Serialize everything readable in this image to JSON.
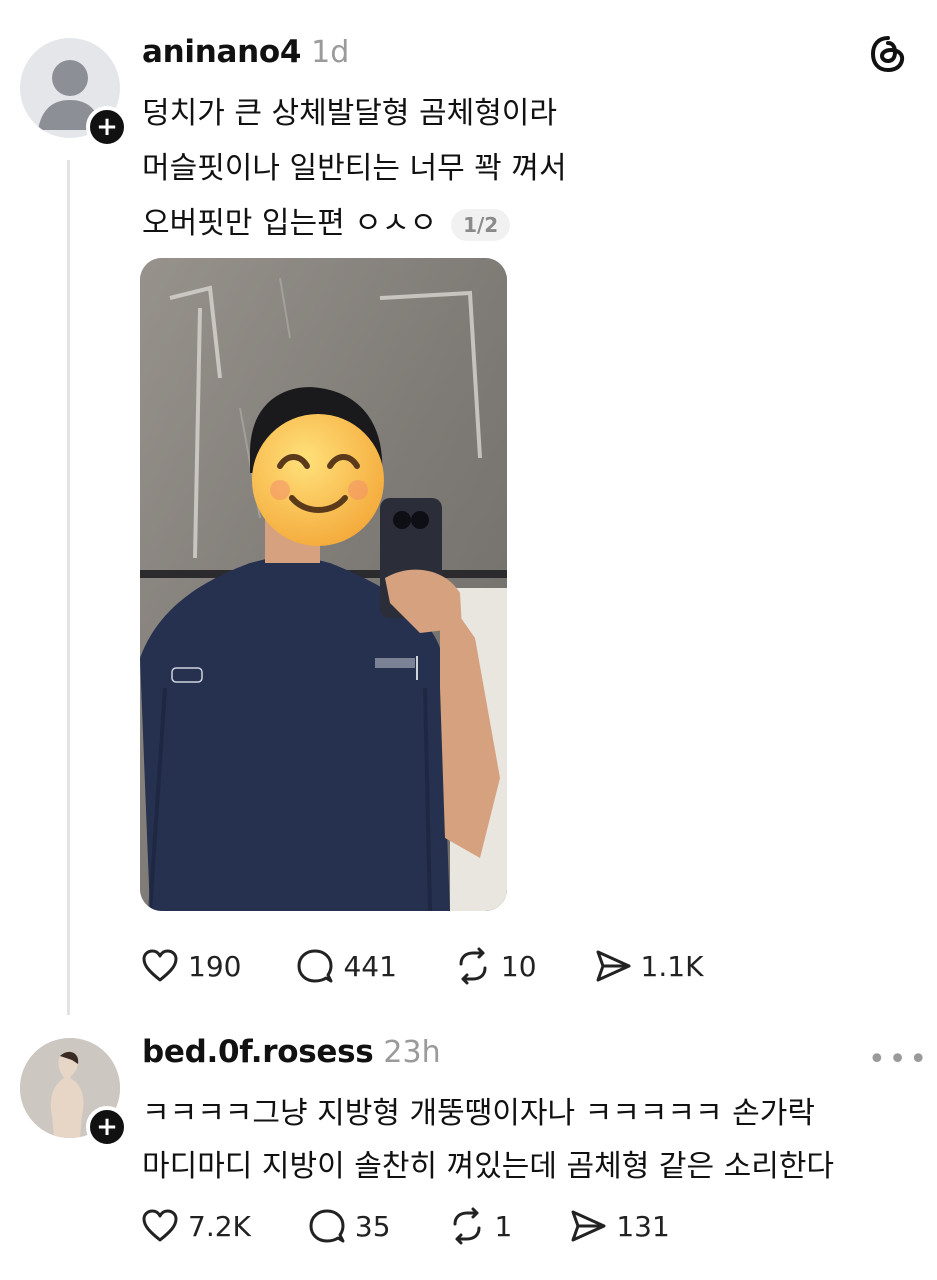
{
  "colors": {
    "text": "#111111",
    "muted": "#9a9a9a",
    "accent_emoji": "#f7c24a"
  },
  "post1": {
    "username": "aninano4",
    "time": "1d",
    "lines": [
      "덩치가 큰 상체발달형 곰체형이라",
      "머슬핏이나 일반티는 너무 꽉 껴서",
      "오버핏만 입는편 ㅇㅅㅇ"
    ],
    "page_counter": "1/2",
    "likes": "190",
    "replies": "441",
    "reposts": "10",
    "shares": "1.1K"
  },
  "post2": {
    "username": "bed.0f.rosess",
    "time": "23h",
    "lines": [
      "ㅋㅋㅋㅋ그냥 지방형 개뚱땡이자나 ㅋㅋㅋㅋㅋ 손가락",
      "마디마디 지방이 솔찬히 껴있는데 곰체형 같은 소리한다"
    ],
    "likes": "7.2K",
    "replies": "35",
    "reposts": "1",
    "shares": "131",
    "more_icon": "ellipsis-icon"
  },
  "icons": [
    "threads-logo-icon",
    "heart-icon",
    "reply-icon",
    "repost-icon",
    "share-icon",
    "plus-icon"
  ]
}
